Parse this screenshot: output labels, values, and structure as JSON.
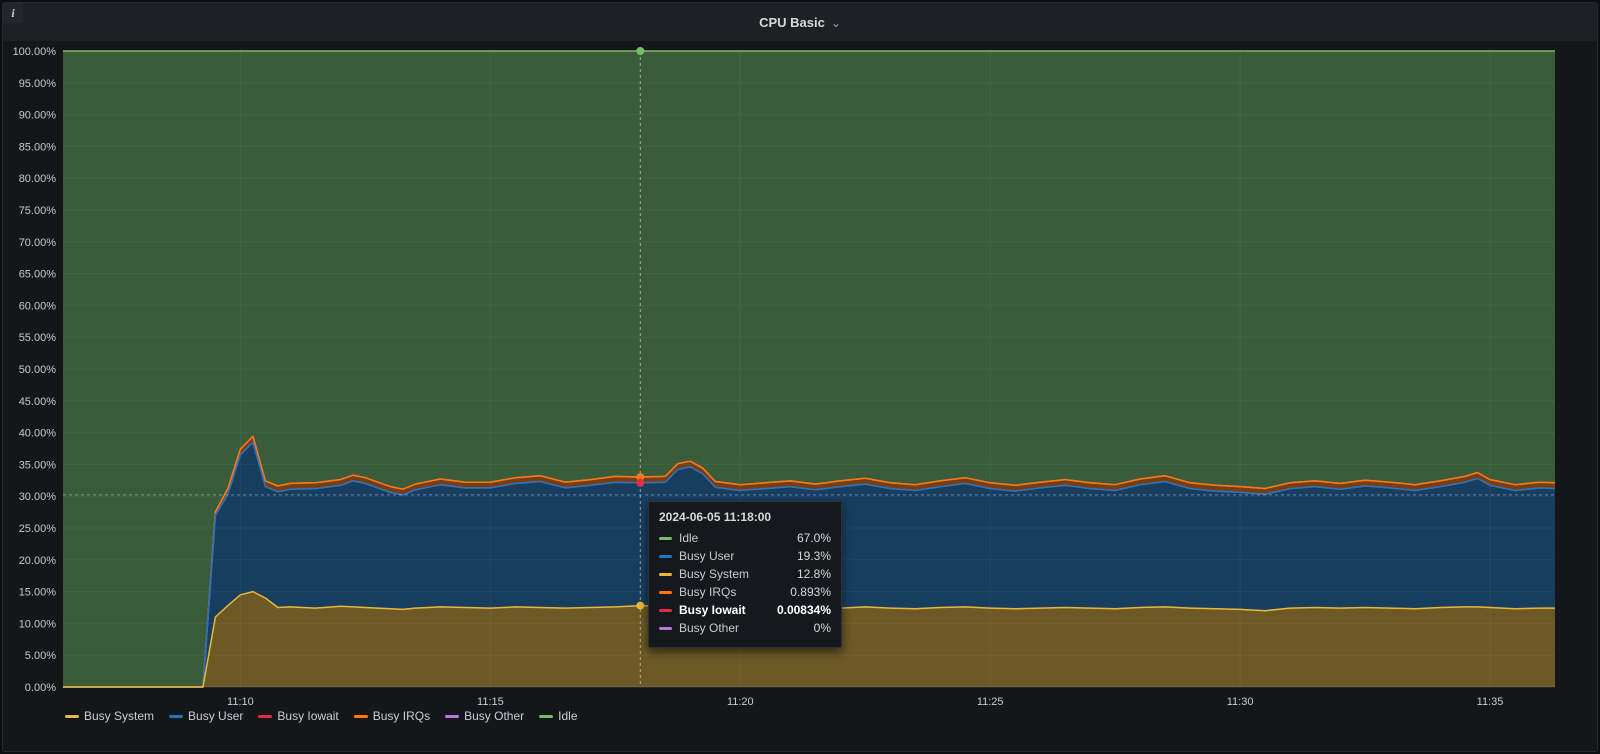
{
  "panel": {
    "title": "CPU Basic",
    "menu_icon": "⌄",
    "info_icon": "i"
  },
  "tooltip": {
    "title": "2024-06-05 11:18:00",
    "rows": [
      {
        "label": "Idle",
        "value": "67.0%",
        "color": "#73BF69",
        "bold": false
      },
      {
        "label": "Busy User",
        "value": "19.3%",
        "color": "#1F78C1",
        "bold": false
      },
      {
        "label": "Busy System",
        "value": "12.8%",
        "color": "#EAB839",
        "bold": false
      },
      {
        "label": "Busy IRQs",
        "value": "0.893%",
        "color": "#FF780A",
        "bold": false
      },
      {
        "label": "Busy Iowait",
        "value": "0.00834%",
        "color": "#E02F44",
        "bold": true
      },
      {
        "label": "Busy Other",
        "value": "0%",
        "color": "#B877D9",
        "bold": false
      }
    ]
  },
  "legend": {
    "items": [
      {
        "label": "Busy System",
        "color": "#EAB839"
      },
      {
        "label": "Busy User",
        "color": "#1F78C1"
      },
      {
        "label": "Busy Iowait",
        "color": "#E02F44"
      },
      {
        "label": "Busy IRQs",
        "color": "#FF780A"
      },
      {
        "label": "Busy Other",
        "color": "#B877D9"
      },
      {
        "label": "Idle",
        "color": "#73BF69"
      }
    ]
  },
  "crosshair": {
    "t": 18,
    "y_percent": 30.2,
    "vertical_color": "rgba(214,223,180,0.65)",
    "horizontal_color": "rgba(150,176,219,0.65)",
    "points": [
      {
        "series": "Idle",
        "color": "#73BF69",
        "y": 100
      },
      {
        "series": "Busy IRQs",
        "color": "#FF780A",
        "y": 33.01
      },
      {
        "series": "Busy User",
        "color": "#1F78C1",
        "y": 32.1
      },
      {
        "series": "Busy Iowait",
        "color": "#E02F44",
        "y": 32.11
      },
      {
        "series": "Busy System",
        "color": "#EAB839",
        "y": 12.8
      }
    ]
  },
  "chart_data": {
    "type": "area",
    "stacked": true,
    "title": "CPU Basic",
    "xlabel": "",
    "ylabel": "",
    "ylim": [
      0,
      100
    ],
    "fill_opacity": 0.42,
    "grid": true,
    "x_unit": "minutes after 11:00",
    "y_ticks": [
      {
        "v": 100,
        "label": "100.00%"
      },
      {
        "v": 95,
        "label": "95.00%"
      },
      {
        "v": 90,
        "label": "90.00%"
      },
      {
        "v": 85,
        "label": "85.00%"
      },
      {
        "v": 80,
        "label": "80.00%"
      },
      {
        "v": 75,
        "label": "75.00%"
      },
      {
        "v": 70,
        "label": "70.00%"
      },
      {
        "v": 65,
        "label": "65.00%"
      },
      {
        "v": 60,
        "label": "60.00%"
      },
      {
        "v": 55,
        "label": "55.00%"
      },
      {
        "v": 50,
        "label": "50.00%"
      },
      {
        "v": 45,
        "label": "45.00%"
      },
      {
        "v": 40,
        "label": "40.00%"
      },
      {
        "v": 35,
        "label": "35.00%"
      },
      {
        "v": 30,
        "label": "30.00%"
      },
      {
        "v": 25,
        "label": "25.00%"
      },
      {
        "v": 20,
        "label": "20.00%"
      },
      {
        "v": 15,
        "label": "15.00%"
      },
      {
        "v": 10,
        "label": "10.00%"
      },
      {
        "v": 5,
        "label": "5.00%"
      },
      {
        "v": 0,
        "label": "0.00%"
      }
    ],
    "x_ticks": [
      {
        "t": 10,
        "label": "11:10"
      },
      {
        "t": 15,
        "label": "11:15"
      },
      {
        "t": 20,
        "label": "11:20"
      },
      {
        "t": 25,
        "label": "11:25"
      },
      {
        "t": 30,
        "label": "11:30"
      },
      {
        "t": 35,
        "label": "11:35"
      }
    ],
    "x": [
      6.45,
      7,
      7.5,
      8,
      8.5,
      9,
      9.25,
      9.5,
      9.75,
      10,
      10.25,
      10.5,
      10.75,
      11,
      11.5,
      12,
      12.25,
      12.5,
      13,
      13.25,
      13.5,
      14,
      14.5,
      15,
      15.5,
      16,
      16.5,
      17,
      17.5,
      18,
      18.5,
      18.75,
      19,
      19.25,
      19.5,
      20,
      20.5,
      21,
      21.5,
      22,
      22.5,
      23,
      23.5,
      24,
      24.5,
      25,
      25.5,
      26,
      26.5,
      27,
      27.5,
      28,
      28.5,
      29,
      29.5,
      30,
      30.5,
      31,
      31.5,
      32,
      32.5,
      33,
      33.5,
      34,
      34.5,
      34.75,
      35,
      35.5,
      36,
      36.3
    ],
    "series": [
      {
        "name": "Busy System",
        "color": "#EAB839",
        "values": [
          0,
          0,
          0,
          0,
          0,
          0,
          0,
          11,
          12.8,
          14.5,
          15,
          14,
          12.5,
          12.6,
          12.4,
          12.7,
          12.6,
          12.5,
          12.3,
          12.2,
          12.4,
          12.6,
          12.5,
          12.4,
          12.6,
          12.5,
          12.4,
          12.5,
          12.6,
          12.8,
          12.7,
          12.7,
          12.6,
          12.5,
          12.4,
          12.3,
          12.4,
          12.5,
          12.3,
          12.4,
          12.6,
          12.4,
          12.3,
          12.5,
          12.6,
          12.4,
          12.3,
          12.4,
          12.5,
          12.4,
          12.3,
          12.5,
          12.6,
          12.4,
          12.3,
          12.2,
          12,
          12.4,
          12.5,
          12.4,
          12.5,
          12.4,
          12.3,
          12.5,
          12.6,
          12.6,
          12.5,
          12.3,
          12.4,
          12.4
        ]
      },
      {
        "name": "Busy User",
        "color": "#1F78C1",
        "values": [
          0,
          0,
          0,
          0,
          0,
          0,
          0,
          16,
          17.5,
          22,
          23.5,
          17.5,
          18.2,
          18.5,
          18.8,
          19,
          19.8,
          19.5,
          18.3,
          18,
          18.6,
          19.2,
          18.8,
          18.9,
          19.4,
          19.8,
          18.9,
          19.2,
          19.6,
          19.3,
          19.5,
          21.5,
          22,
          21,
          19,
          18.6,
          18.8,
          19,
          18.7,
          19.1,
          19.3,
          18.8,
          18.6,
          19,
          19.4,
          18.8,
          18.5,
          18.9,
          19.2,
          18.8,
          18.6,
          19.3,
          19.7,
          18.8,
          18.5,
          18.4,
          18.3,
          18.8,
          19,
          18.7,
          19.1,
          18.9,
          18.6,
          19,
          19.6,
          20.2,
          19.2,
          18.6,
          18.9,
          18.8
        ]
      },
      {
        "name": "Busy Iowait",
        "color": "#E02F44",
        "values": [
          0,
          0,
          0,
          0,
          0,
          0,
          0,
          0.008,
          0.008,
          0.008,
          0.008,
          0.008,
          0.008,
          0.008,
          0.008,
          0.008,
          0.008,
          0.008,
          0.008,
          0.008,
          0.008,
          0.008,
          0.008,
          0.008,
          0.008,
          0.008,
          0.008,
          0.008,
          0.008,
          0.008,
          0.008,
          0.008,
          0.008,
          0.008,
          0.008,
          0.008,
          0.008,
          0.008,
          0.008,
          0.008,
          0.008,
          0.008,
          0.008,
          0.008,
          0.008,
          0.008,
          0.008,
          0.008,
          0.008,
          0.008,
          0.008,
          0.008,
          0.008,
          0.008,
          0.008,
          0.008,
          0.008,
          0.008,
          0.008,
          0.008,
          0.008,
          0.008,
          0.008,
          0.008,
          0.008,
          0.008,
          0.008,
          0.008,
          0.008,
          0.008
        ]
      },
      {
        "name": "Busy IRQs",
        "color": "#FF780A",
        "values": [
          0,
          0,
          0,
          0,
          0,
          0,
          0,
          0.5,
          0.9,
          0.9,
          0.9,
          0.9,
          0.9,
          0.9,
          0.9,
          0.9,
          0.9,
          0.9,
          0.9,
          0.9,
          0.9,
          0.9,
          0.9,
          0.9,
          0.9,
          0.9,
          0.9,
          0.9,
          0.9,
          0.9,
          0.9,
          0.9,
          0.9,
          0.9,
          0.9,
          0.9,
          0.9,
          0.9,
          0.9,
          0.9,
          0.9,
          0.9,
          0.9,
          0.9,
          0.9,
          0.9,
          0.9,
          0.9,
          0.9,
          0.9,
          0.9,
          0.9,
          0.9,
          0.9,
          0.9,
          0.9,
          0.9,
          0.9,
          0.9,
          0.9,
          0.9,
          0.9,
          0.9,
          0.9,
          0.9,
          0.9,
          0.9,
          0.9,
          0.9,
          0.9
        ]
      },
      {
        "name": "Busy Other",
        "color": "#B877D9",
        "values": [
          0,
          0,
          0,
          0,
          0,
          0,
          0,
          0,
          0,
          0,
          0,
          0,
          0,
          0,
          0,
          0,
          0,
          0,
          0,
          0,
          0,
          0,
          0,
          0,
          0,
          0,
          0,
          0,
          0,
          0,
          0,
          0,
          0,
          0,
          0,
          0,
          0,
          0,
          0,
          0,
          0,
          0,
          0,
          0,
          0,
          0,
          0,
          0,
          0,
          0,
          0,
          0,
          0,
          0,
          0,
          0,
          0,
          0,
          0,
          0,
          0,
          0,
          0,
          0,
          0,
          0,
          0,
          0,
          0,
          0
        ]
      },
      {
        "name": "Idle",
        "color": "#73BF69",
        "values": "remainder_to_100"
      }
    ]
  }
}
